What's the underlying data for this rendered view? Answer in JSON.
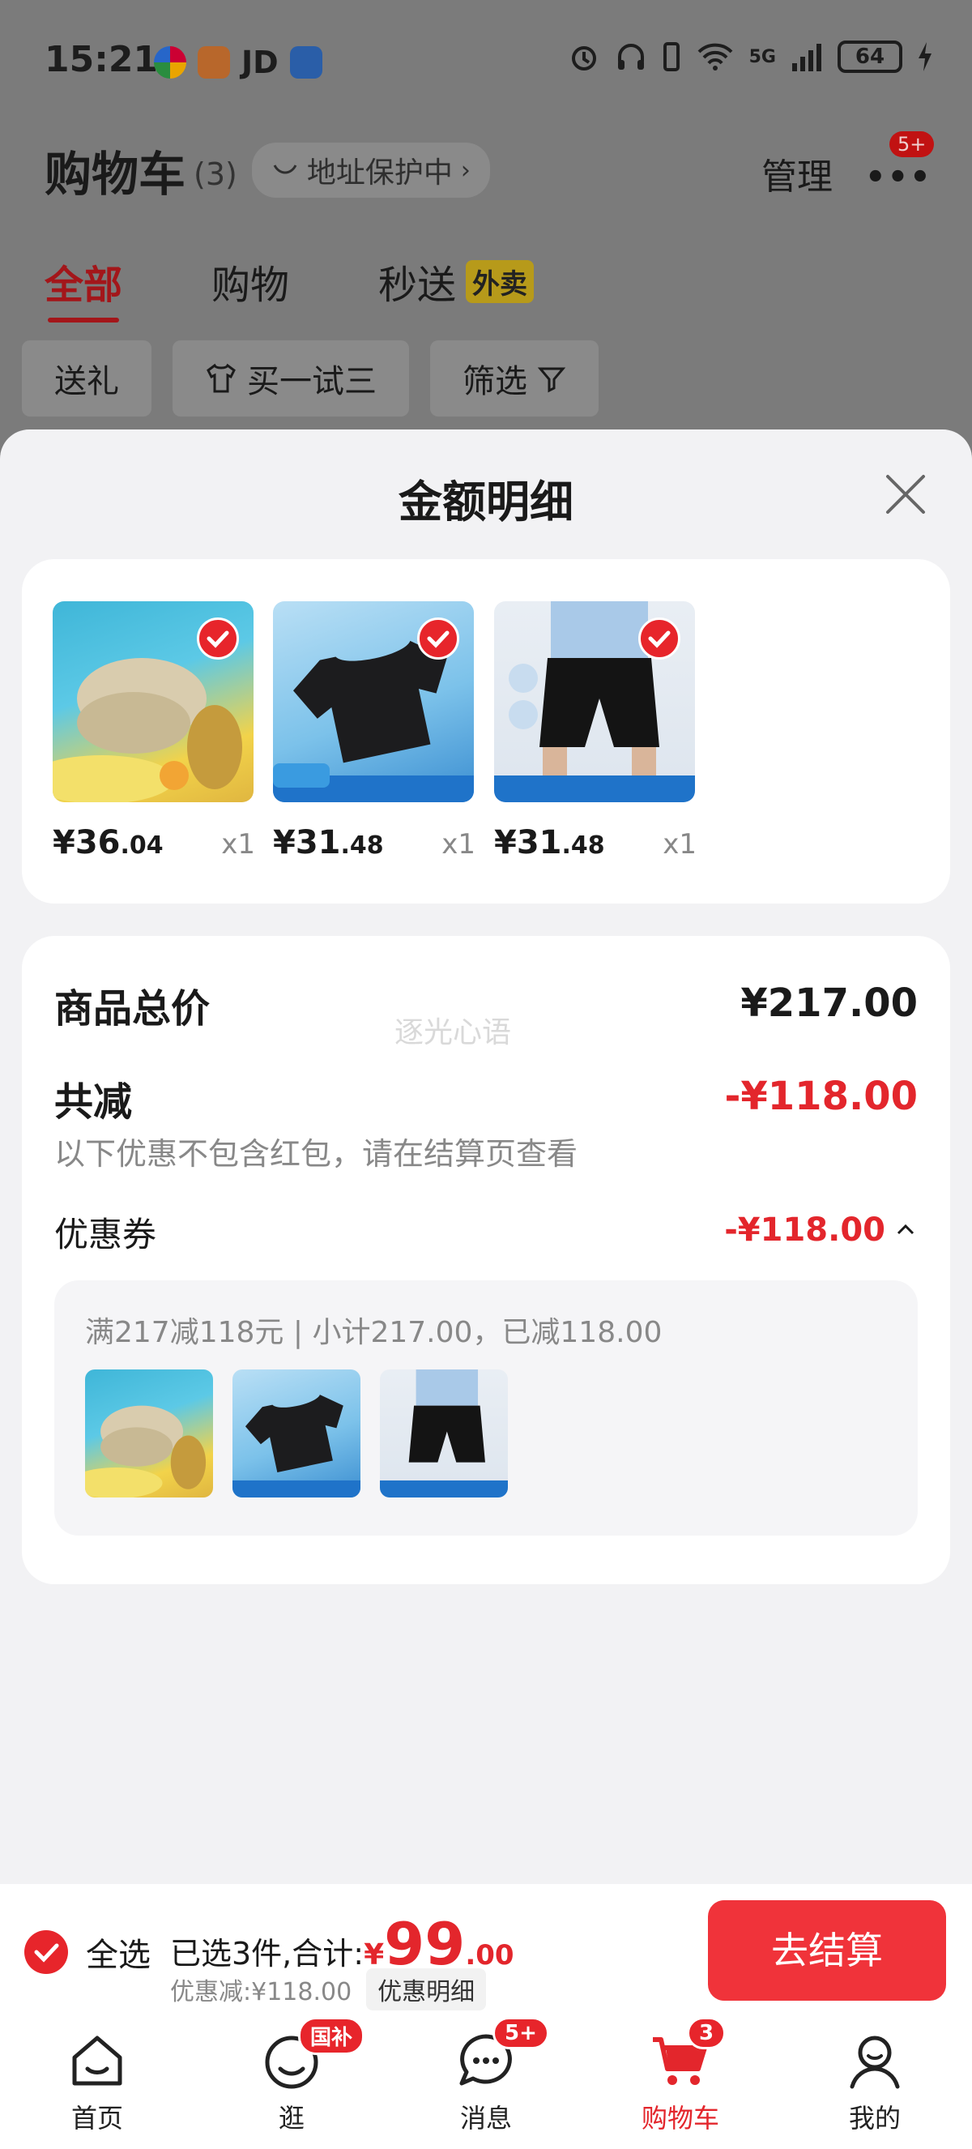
{
  "status_bar": {
    "time": "15:21",
    "jd_label": "JD",
    "network": "5G",
    "battery": "64"
  },
  "background": {
    "title": "购物车",
    "count": "(3)",
    "address_chip": "地址保护中",
    "manage": "管理",
    "more_badge": "5+",
    "tabs": [
      "全部",
      "购物",
      "秒送"
    ],
    "waimai_badge": "外卖",
    "filters": [
      "送礼",
      "买一试三",
      "筛选"
    ]
  },
  "sheet": {
    "title": "金额明细",
    "products": [
      {
        "price_int": "¥36",
        "price_dec": ".04",
        "qty": "x1"
      },
      {
        "price_int": "¥31",
        "price_dec": ".48",
        "qty": "x1"
      },
      {
        "price_int": "¥31",
        "price_dec": ".48",
        "qty": "x1"
      }
    ],
    "summary": {
      "total_label": "商品总价",
      "total_value": "¥217.00",
      "watermark": "逐光心语",
      "reduce_label": "共减",
      "reduce_value": "-¥118.00",
      "reduce_note": "以下优惠不包含红包，请在结算页查看",
      "coupon_label": "优惠券",
      "coupon_value": "-¥118.00",
      "coupon_detail": "满217减118元 | 小计217.00，已减118.00"
    }
  },
  "checkout": {
    "select_all": "全选",
    "sum_prefix": "已选3件,合计:",
    "sum_yen": "¥",
    "sum_int": "99",
    "sum_dec": ".00",
    "discount": "优惠减:¥118.00",
    "detail_chip": "优惠明细",
    "button": "去结算"
  },
  "nav": {
    "items": [
      {
        "label": "首页",
        "icon": "home-icon"
      },
      {
        "label": "逛",
        "icon": "face-icon",
        "badge": "国补"
      },
      {
        "label": "消息",
        "icon": "message-icon",
        "badge": "5+"
      },
      {
        "label": "购物车",
        "icon": "cart-icon",
        "badge": "3"
      },
      {
        "label": "我的",
        "icon": "user-icon"
      }
    ]
  },
  "colors": {
    "accent": "#e7252b",
    "price_red": "#e3262c",
    "sheet_bg": "#f2f2f4"
  }
}
